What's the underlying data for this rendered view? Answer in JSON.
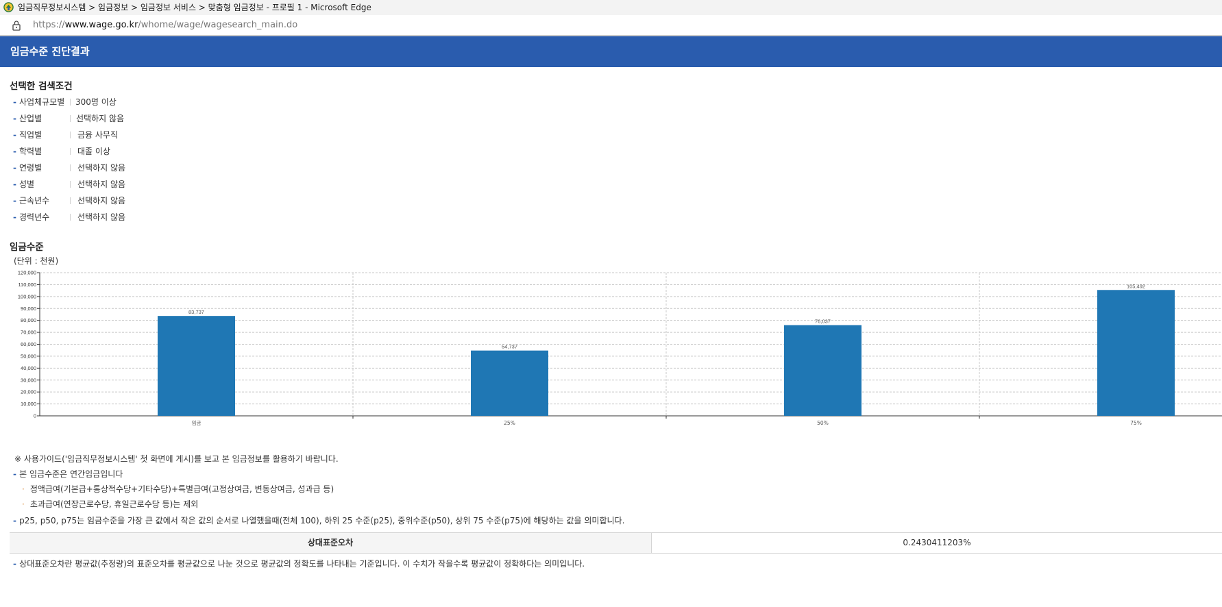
{
  "window": {
    "title": "임금직무정보시스템 > 임금정보 > 임금정보 서비스 > 맞춤형 임금정보 - 프로필 1 - Microsoft Edge",
    "url_prefix": "https://",
    "url_domain": "www.wage.go.kr",
    "url_path": "/whome/wage/wagesearch_main.do"
  },
  "header": {
    "title": "임금수준 진단결과"
  },
  "conditions": {
    "heading": "선택한 검색조건",
    "items": [
      {
        "label": "사업체규모별",
        "value": "300명 이상"
      },
      {
        "label": "산업별",
        "value": "선택하지 않음"
      },
      {
        "label": "직업별",
        "value": "금융 사무직"
      },
      {
        "label": "학력별",
        "value": "대졸 이상"
      },
      {
        "label": "연령별",
        "value": "선택하지 않음"
      },
      {
        "label": "성별",
        "value": "선택하지 않음"
      },
      {
        "label": "근속년수",
        "value": "선택하지 않음"
      },
      {
        "label": "경력년수",
        "value": "선택하지 않음"
      }
    ]
  },
  "wage_section": {
    "heading": "임금수준",
    "unit": "(단위 : 천원)"
  },
  "chart_data": {
    "type": "bar",
    "categories": [
      "임금",
      "25%",
      "50%",
      "75%"
    ],
    "values": [
      83737,
      54737,
      76037,
      105492
    ],
    "value_labels": [
      "83,737",
      "54,737",
      "76,037",
      "105,492"
    ],
    "yticks": [
      "0",
      "10,000",
      "20,000",
      "30,000",
      "40,000",
      "50,000",
      "60,000",
      "70,000",
      "80,000",
      "90,000",
      "100,000",
      "110,000",
      "120,000"
    ],
    "ylim": [
      0,
      120000
    ],
    "grid": true,
    "bar_color": "#1f77b4",
    "title": "",
    "xlabel": "",
    "ylabel": ""
  },
  "notes": {
    "guide": "※ 사용가이드('임금직무정보시스템' 첫 화면에 게시)를 보고 본 임금정보를 활용하기 바랍니다.",
    "annual": "본 임금수준은 연간임금입니다",
    "includes": "정액급여(기본급+통상적수당+기타수당)+특별급여(고정상여금, 변동상여금, 성과급 등)",
    "excludes": "초과급여(연장근로수당, 휴일근로수당 등)는 제외",
    "percentile": "p25, p50, p75는 임금수준을 가장 큰 값에서 작은 값의 순서로 나열했을때(전체 100), 하위 25 수준(p25), 중위수준(p50), 상위 75 수준(p75)에 해당하는 값을 의미합니다.",
    "rse_explain": "상대표준오차란 평균값(추정량)의 표준오차를 평균값으로 나눈 것으로 평균값의 정확도를 나타내는 기준입니다. 이 수치가 작을수록 평균값이 정확하다는 의미입니다."
  },
  "rse_table": {
    "header": "상대표준오차",
    "value": "0.2430411203%"
  }
}
